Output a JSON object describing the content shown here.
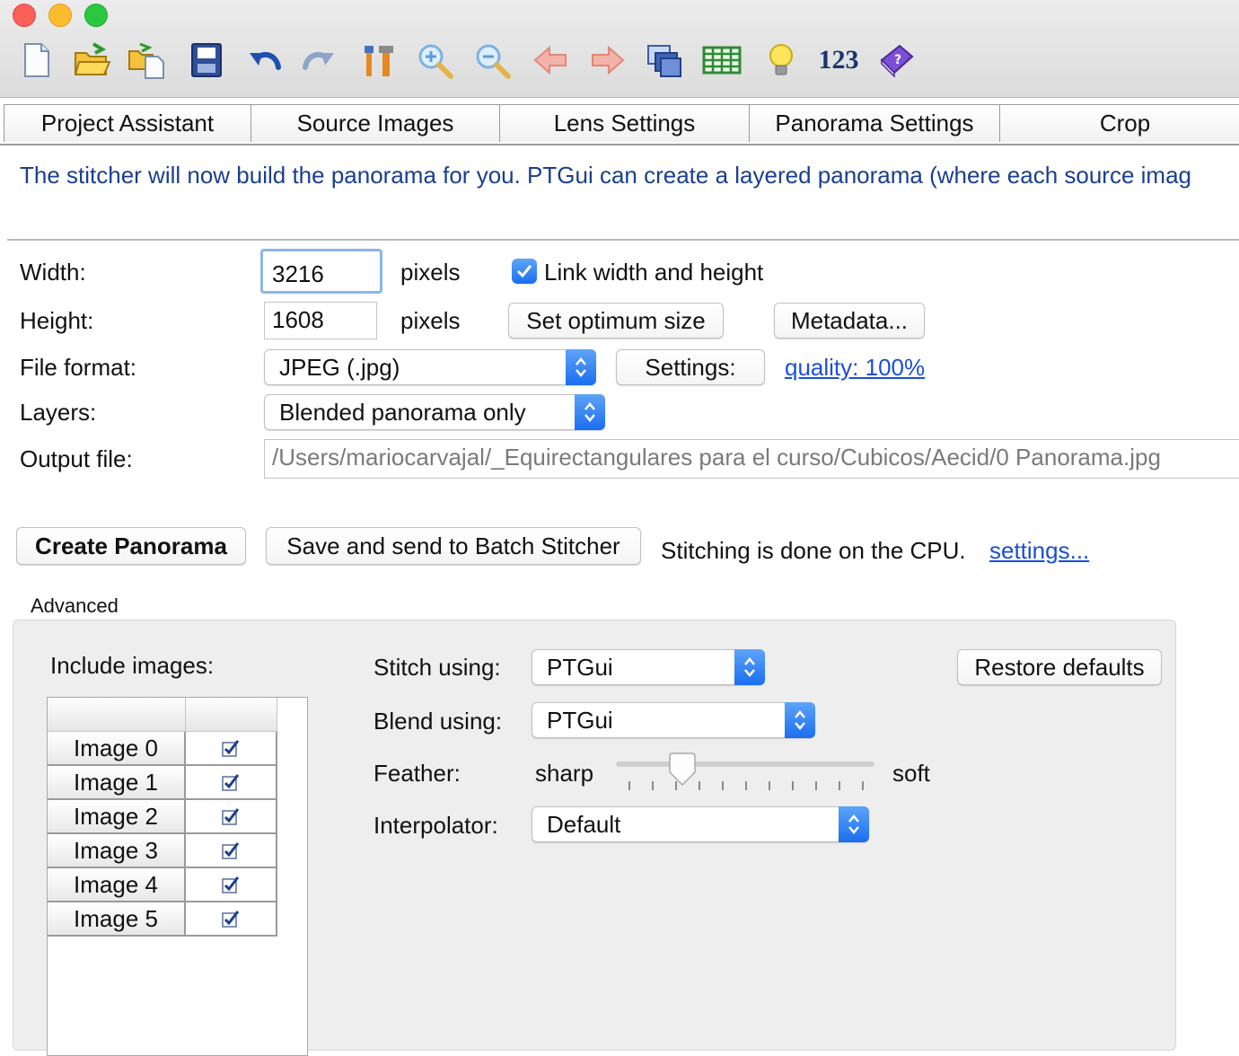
{
  "window": {
    "traffic_lights": {
      "close": "#fc5f57",
      "minimize": "#fdbc2e",
      "zoom": "#29c840"
    }
  },
  "toolbar": {
    "icons": [
      "new-document-icon",
      "open-folder-icon",
      "open-recent-icon",
      "save-icon",
      "undo-icon",
      "redo-icon",
      "tools-icon",
      "zoom-in-icon",
      "zoom-out-icon",
      "arrow-left-icon",
      "arrow-right-icon",
      "panorama-editor-icon",
      "table-icon",
      "lightbulb-icon",
      "numbering-icon",
      "help-book-icon"
    ],
    "numbers_label": "123"
  },
  "tabs": [
    "Project Assistant",
    "Source Images",
    "Lens Settings",
    "Panorama Settings",
    "Crop"
  ],
  "info_text": "The stitcher will now build the panorama for you. PTGui can create a layered panorama (where each source imag",
  "form": {
    "width_label": "Width:",
    "width_value": "3216",
    "width_unit": "pixels",
    "link_label": "Link width and height",
    "link_checked": true,
    "height_label": "Height:",
    "height_value": "1608",
    "height_unit": "pixels",
    "set_optimum_button": "Set optimum size",
    "metadata_button": "Metadata...",
    "file_format_label": "File format:",
    "file_format_value": "JPEG (.jpg)",
    "settings_button": "Settings:",
    "quality_link": "quality: 100%",
    "layers_label": "Layers:",
    "layers_value": "Blended panorama only",
    "output_label": "Output file:",
    "output_value": "/Users/mariocarvajal/_Equirectangulares para el curso/Cubicos/Aecid/0 Panorama.jpg"
  },
  "actions": {
    "create_button": "Create Panorama",
    "batch_button": "Save and send to Batch Stitcher",
    "cpu_text": "Stitching is done on the CPU.",
    "settings_link": "settings..."
  },
  "advanced": {
    "title": "Advanced",
    "include_label": "Include images:",
    "images": [
      {
        "name": "Image 0",
        "checked": true
      },
      {
        "name": "Image 1",
        "checked": true
      },
      {
        "name": "Image 2",
        "checked": true
      },
      {
        "name": "Image 3",
        "checked": true
      },
      {
        "name": "Image 4",
        "checked": true
      },
      {
        "name": "Image 5",
        "checked": true
      }
    ],
    "stitch_label": "Stitch using:",
    "stitch_value": "PTGui",
    "blend_label": "Blend using:",
    "blend_value": "PTGui",
    "feather_label": "Feather:",
    "feather_min": "sharp",
    "feather_max": "soft",
    "feather_level": 0.23,
    "interpolator_label": "Interpolator:",
    "interpolator_value": "Default",
    "restore_button": "Restore defaults"
  },
  "colors": {
    "info_text": "#1a3f8e",
    "link": "#1a4fd6",
    "accent": "#1a6ef0"
  }
}
